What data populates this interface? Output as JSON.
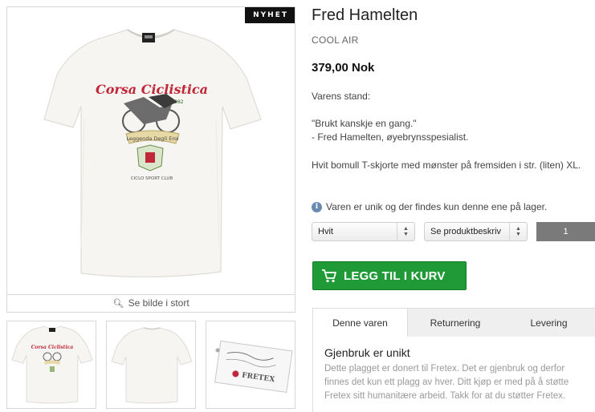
{
  "product": {
    "badge": "NYHET",
    "zoom_label": "Se bilde i stort",
    "title": "Fred Hamelten",
    "brand": "COOL AIR",
    "price": "379,00 Nok",
    "condition_label": "Varens stand:",
    "quote_line1": "\"Brukt kanskje en gang.\"",
    "quote_line2": "- Fred Hamelten, øyebrynsspesialist.",
    "description": "Hvit bomull T-skjorte med mønster på fremsiden i str. (liten) XL.",
    "unique_note": "Varen er unik og der findes kun denne ene på lager.",
    "print_text": {
      "title": "Corsa Ciclistica",
      "year": "1982",
      "banner": "Leggenda Degli Eroi",
      "club": "CICLO SPORT CLUB"
    },
    "tag_brand": "FRETEX"
  },
  "options": {
    "color_value": "Hvit",
    "desc_select_value": "Se produktbeskriv",
    "quantity": "1"
  },
  "cart": {
    "button_label": "LEGG TIL I KURV"
  },
  "tabs": [
    {
      "label": "Denne varen",
      "active": true
    },
    {
      "label": "Returnering",
      "active": false
    },
    {
      "label": "Levering",
      "active": false
    }
  ],
  "panel": {
    "title": "Gjenbruk er unikt",
    "text": "Dette plagget er donert til Fretex. Det er gjenbruk og derfor finnes det kun ett plagg av hver. Ditt kjøp er med på å støtte Fretex sitt humanitære arbeid. Takk for at du støtter Fretex."
  },
  "colors": {
    "cart_green": "#1f9a36",
    "badge_bg": "#111111",
    "qty_bg": "#7a7a7a",
    "info_icon": "#6a8bb0"
  },
  "icons": [
    "zoom-icon",
    "info-icon",
    "cart-icon",
    "select-arrows-icon"
  ]
}
